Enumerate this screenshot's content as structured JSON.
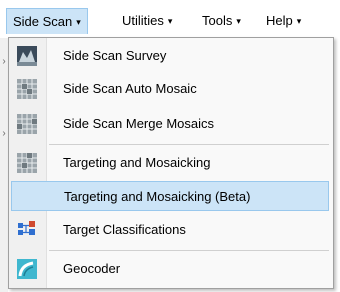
{
  "menubar": {
    "items": [
      {
        "label": "Side Scan"
      },
      {
        "label": "Utilities"
      },
      {
        "label": "Tools"
      },
      {
        "label": "Help"
      }
    ]
  },
  "dropdown": {
    "items": [
      {
        "label": "Side Scan Survey",
        "icon": "survey-icon"
      },
      {
        "label": "Side Scan Auto Mosaic",
        "icon": "mosaic-grid-icon"
      },
      {
        "label": "Side Scan Merge Mosaics",
        "icon": "mosaic-grid-icon"
      },
      {
        "label": "Targeting and Mosaicking",
        "icon": "mosaic-grid-icon"
      },
      {
        "label": "Targeting and Mosaicking (Beta)",
        "icon": "none",
        "selected": true
      },
      {
        "label": "Target Classifications",
        "icon": "target-classification-icon"
      },
      {
        "label": "Geocoder",
        "icon": "geocoder-icon"
      }
    ]
  },
  "colors": {
    "selection_bg": "#cce4f7",
    "selection_border": "#99c8ed"
  }
}
